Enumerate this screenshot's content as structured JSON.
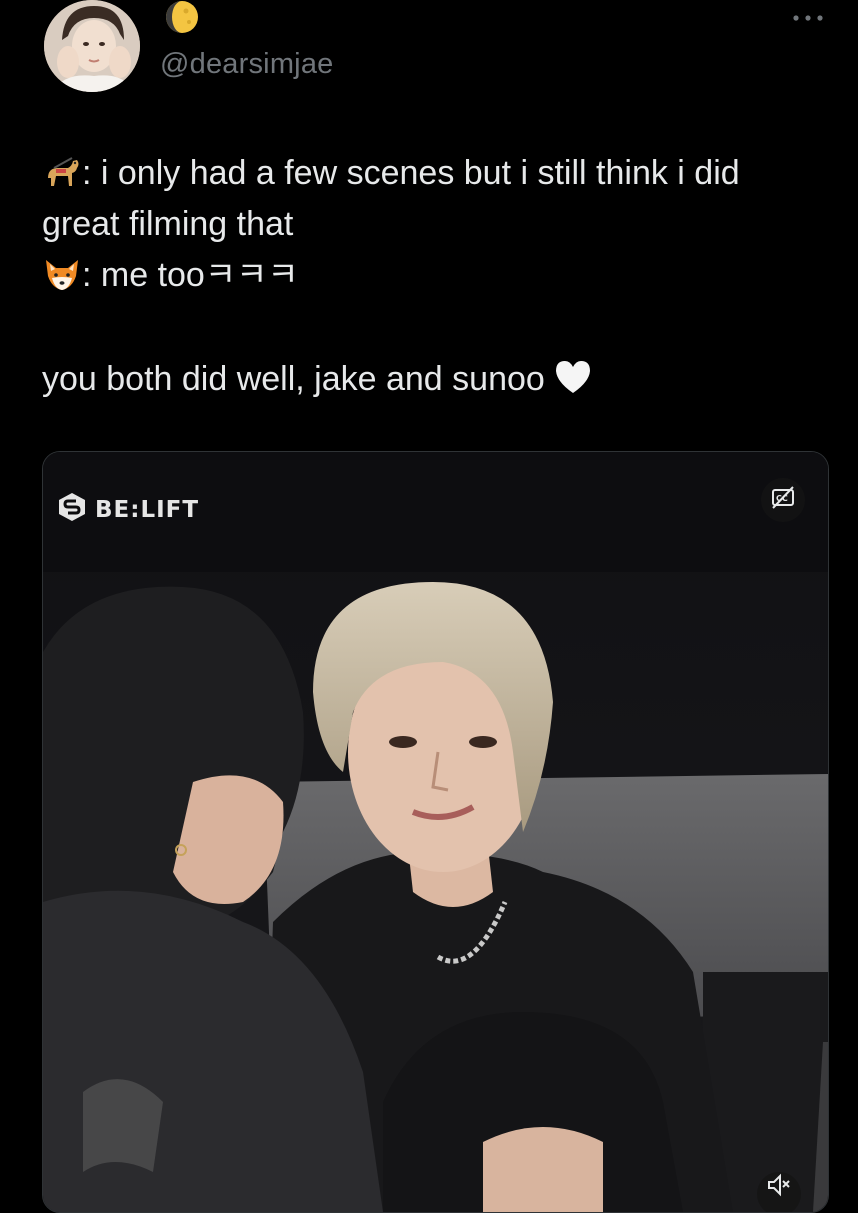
{
  "tweet": {
    "author": {
      "handle": "@dearsimjae",
      "avatar_icon": "avatar-photo",
      "badge_icon": "crescent-moon-emoji"
    },
    "more_icon": "more-dots-icon",
    "text": {
      "line1_emoji": "guide-dog-emoji",
      "line1": ": i only had a few scenes but i still think i did",
      "line2": "great filming that",
      "line3_emoji": "fox-emoji",
      "line3": ": me too",
      "line3_suffix": "ㅋㅋㅋ",
      "line4": "you both did well, jake and sunoo",
      "line4_emoji": "white-heart-emoji"
    },
    "media": {
      "type": "video",
      "brand_icon": "belift-logo-icon",
      "brand_label": "BE:LIFT",
      "captions_icon": "closed-captions-icon",
      "mute_icon": "speaker-muted-icon"
    }
  },
  "colors": {
    "background": "#000000",
    "text": "#e7e9ea",
    "secondary_text": "#71767b",
    "border": "#2f3336"
  }
}
